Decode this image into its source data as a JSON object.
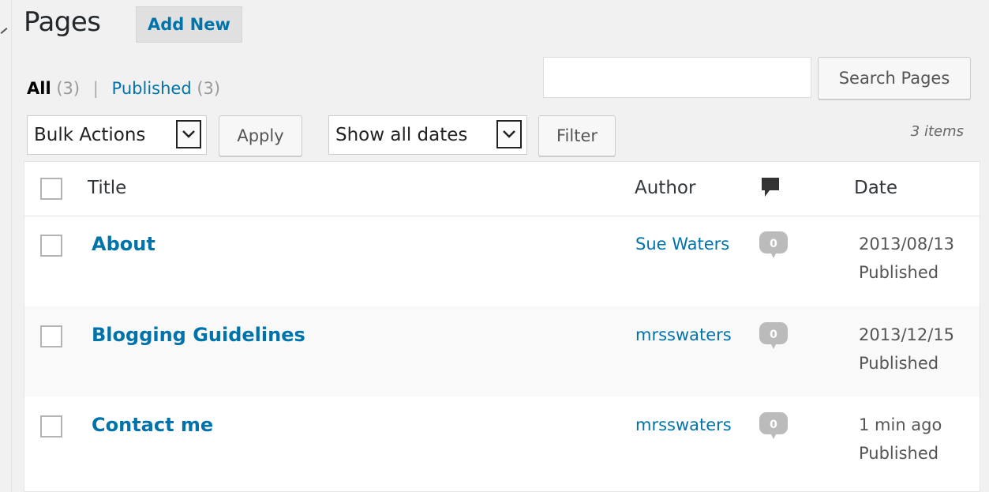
{
  "header": {
    "title": "Pages",
    "add_new_label": "Add New"
  },
  "filters": {
    "all_label": "All",
    "all_count": "(3)",
    "separator": "|",
    "published_label": "Published",
    "published_count": "(3)"
  },
  "search": {
    "value": "",
    "button_label": "Search Pages"
  },
  "tablenav": {
    "bulk_actions_selected": "Bulk Actions",
    "apply_label": "Apply",
    "dates_selected": "Show all dates",
    "filter_label": "Filter",
    "items_count": "3 items"
  },
  "table": {
    "columns": {
      "title": "Title",
      "author": "Author",
      "comments_icon": "comment-bubble-icon",
      "date": "Date"
    },
    "rows": [
      {
        "title": "About",
        "author": "Sue Waters",
        "comments": "0",
        "date": "2013/08/13",
        "status": "Published"
      },
      {
        "title": "Blogging Guidelines",
        "author": "mrsswaters",
        "comments": "0",
        "date": "2013/12/15",
        "status": "Published"
      },
      {
        "title": "Contact me",
        "author": "mrsswaters",
        "comments": "0",
        "date": "1 min ago",
        "status": "Published"
      }
    ]
  },
  "colors": {
    "link": "#0073aa",
    "background": "#f1f1f1",
    "comment_bubble": "#bbbbbb"
  }
}
